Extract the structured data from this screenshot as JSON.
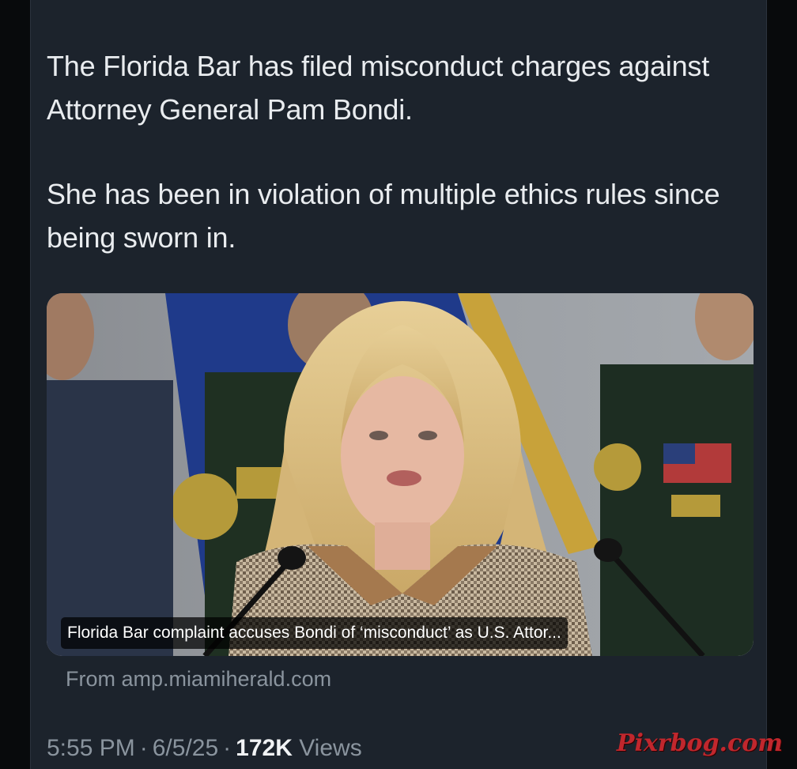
{
  "tweet": {
    "text_paragraph_1": "The Florida Bar has filed misconduct charges against Attorney General Pam Bondi.",
    "text_paragraph_2": "She has been in violation of multiple ethics rules since being sworn in."
  },
  "link_card": {
    "headline": "Florida Bar complaint accuses Bondi of ‘misconduct’ as U.S. Attor...",
    "source": "From amp.miamiherald.com",
    "image_description": "Press conference photo of a blonde woman in a houndstooth jacket speaking into microphones, with uniformed officers and flags behind her"
  },
  "meta": {
    "time": "5:55 PM",
    "date": "6/5/25",
    "separator": "·",
    "views_count": "172K",
    "views_label": "Views"
  },
  "watermark": {
    "text": "Pixrbog.com"
  },
  "colors": {
    "card_background": "#1c232c",
    "text_primary": "#e9ecef",
    "text_secondary": "#8a949e",
    "watermark": "#c1272d"
  }
}
